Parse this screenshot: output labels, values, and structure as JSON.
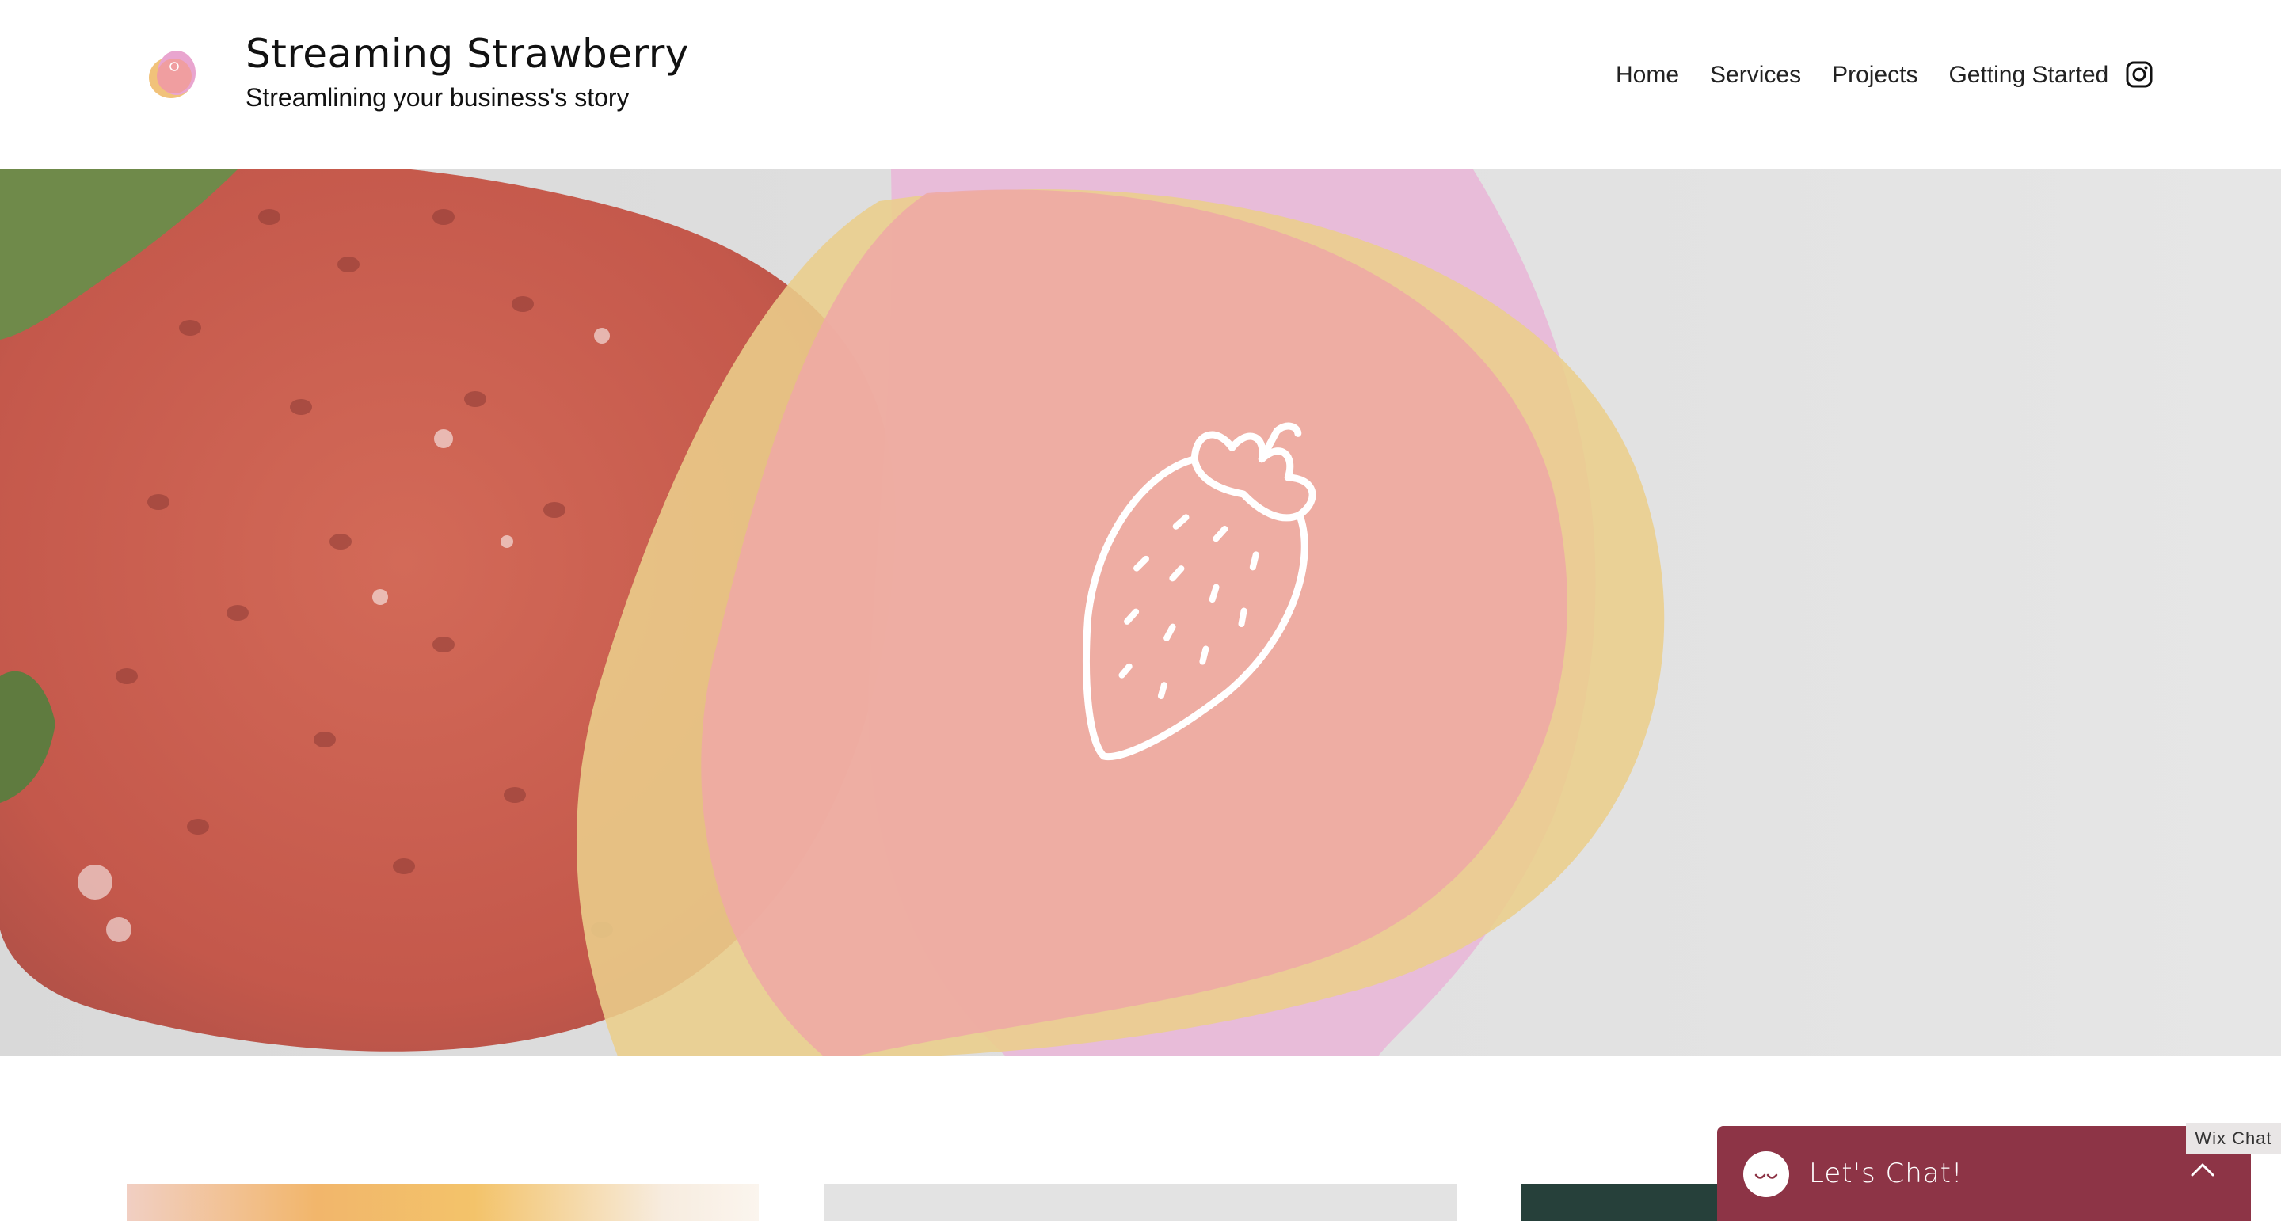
{
  "header": {
    "site_title": "Streaming Strawberry",
    "tagline": "Streamlining your business's story"
  },
  "nav": {
    "items": [
      {
        "label": "Home"
      },
      {
        "label": "Services"
      },
      {
        "label": "Projects"
      },
      {
        "label": "Getting Started"
      }
    ],
    "social_icon": "instagram-icon"
  },
  "hero": {
    "background": "strawberry-photo",
    "overlay_icon": "strawberry-icon",
    "colors": {
      "pink_blob": "#e8b9d8",
      "yellow_blob": "#ebce8b",
      "salmon_blob": "#eeaaa4",
      "background": "#e2e2e2"
    }
  },
  "chat": {
    "label": "Let's Chat!",
    "tag": "Wix Chat",
    "color": "#8d3446"
  }
}
